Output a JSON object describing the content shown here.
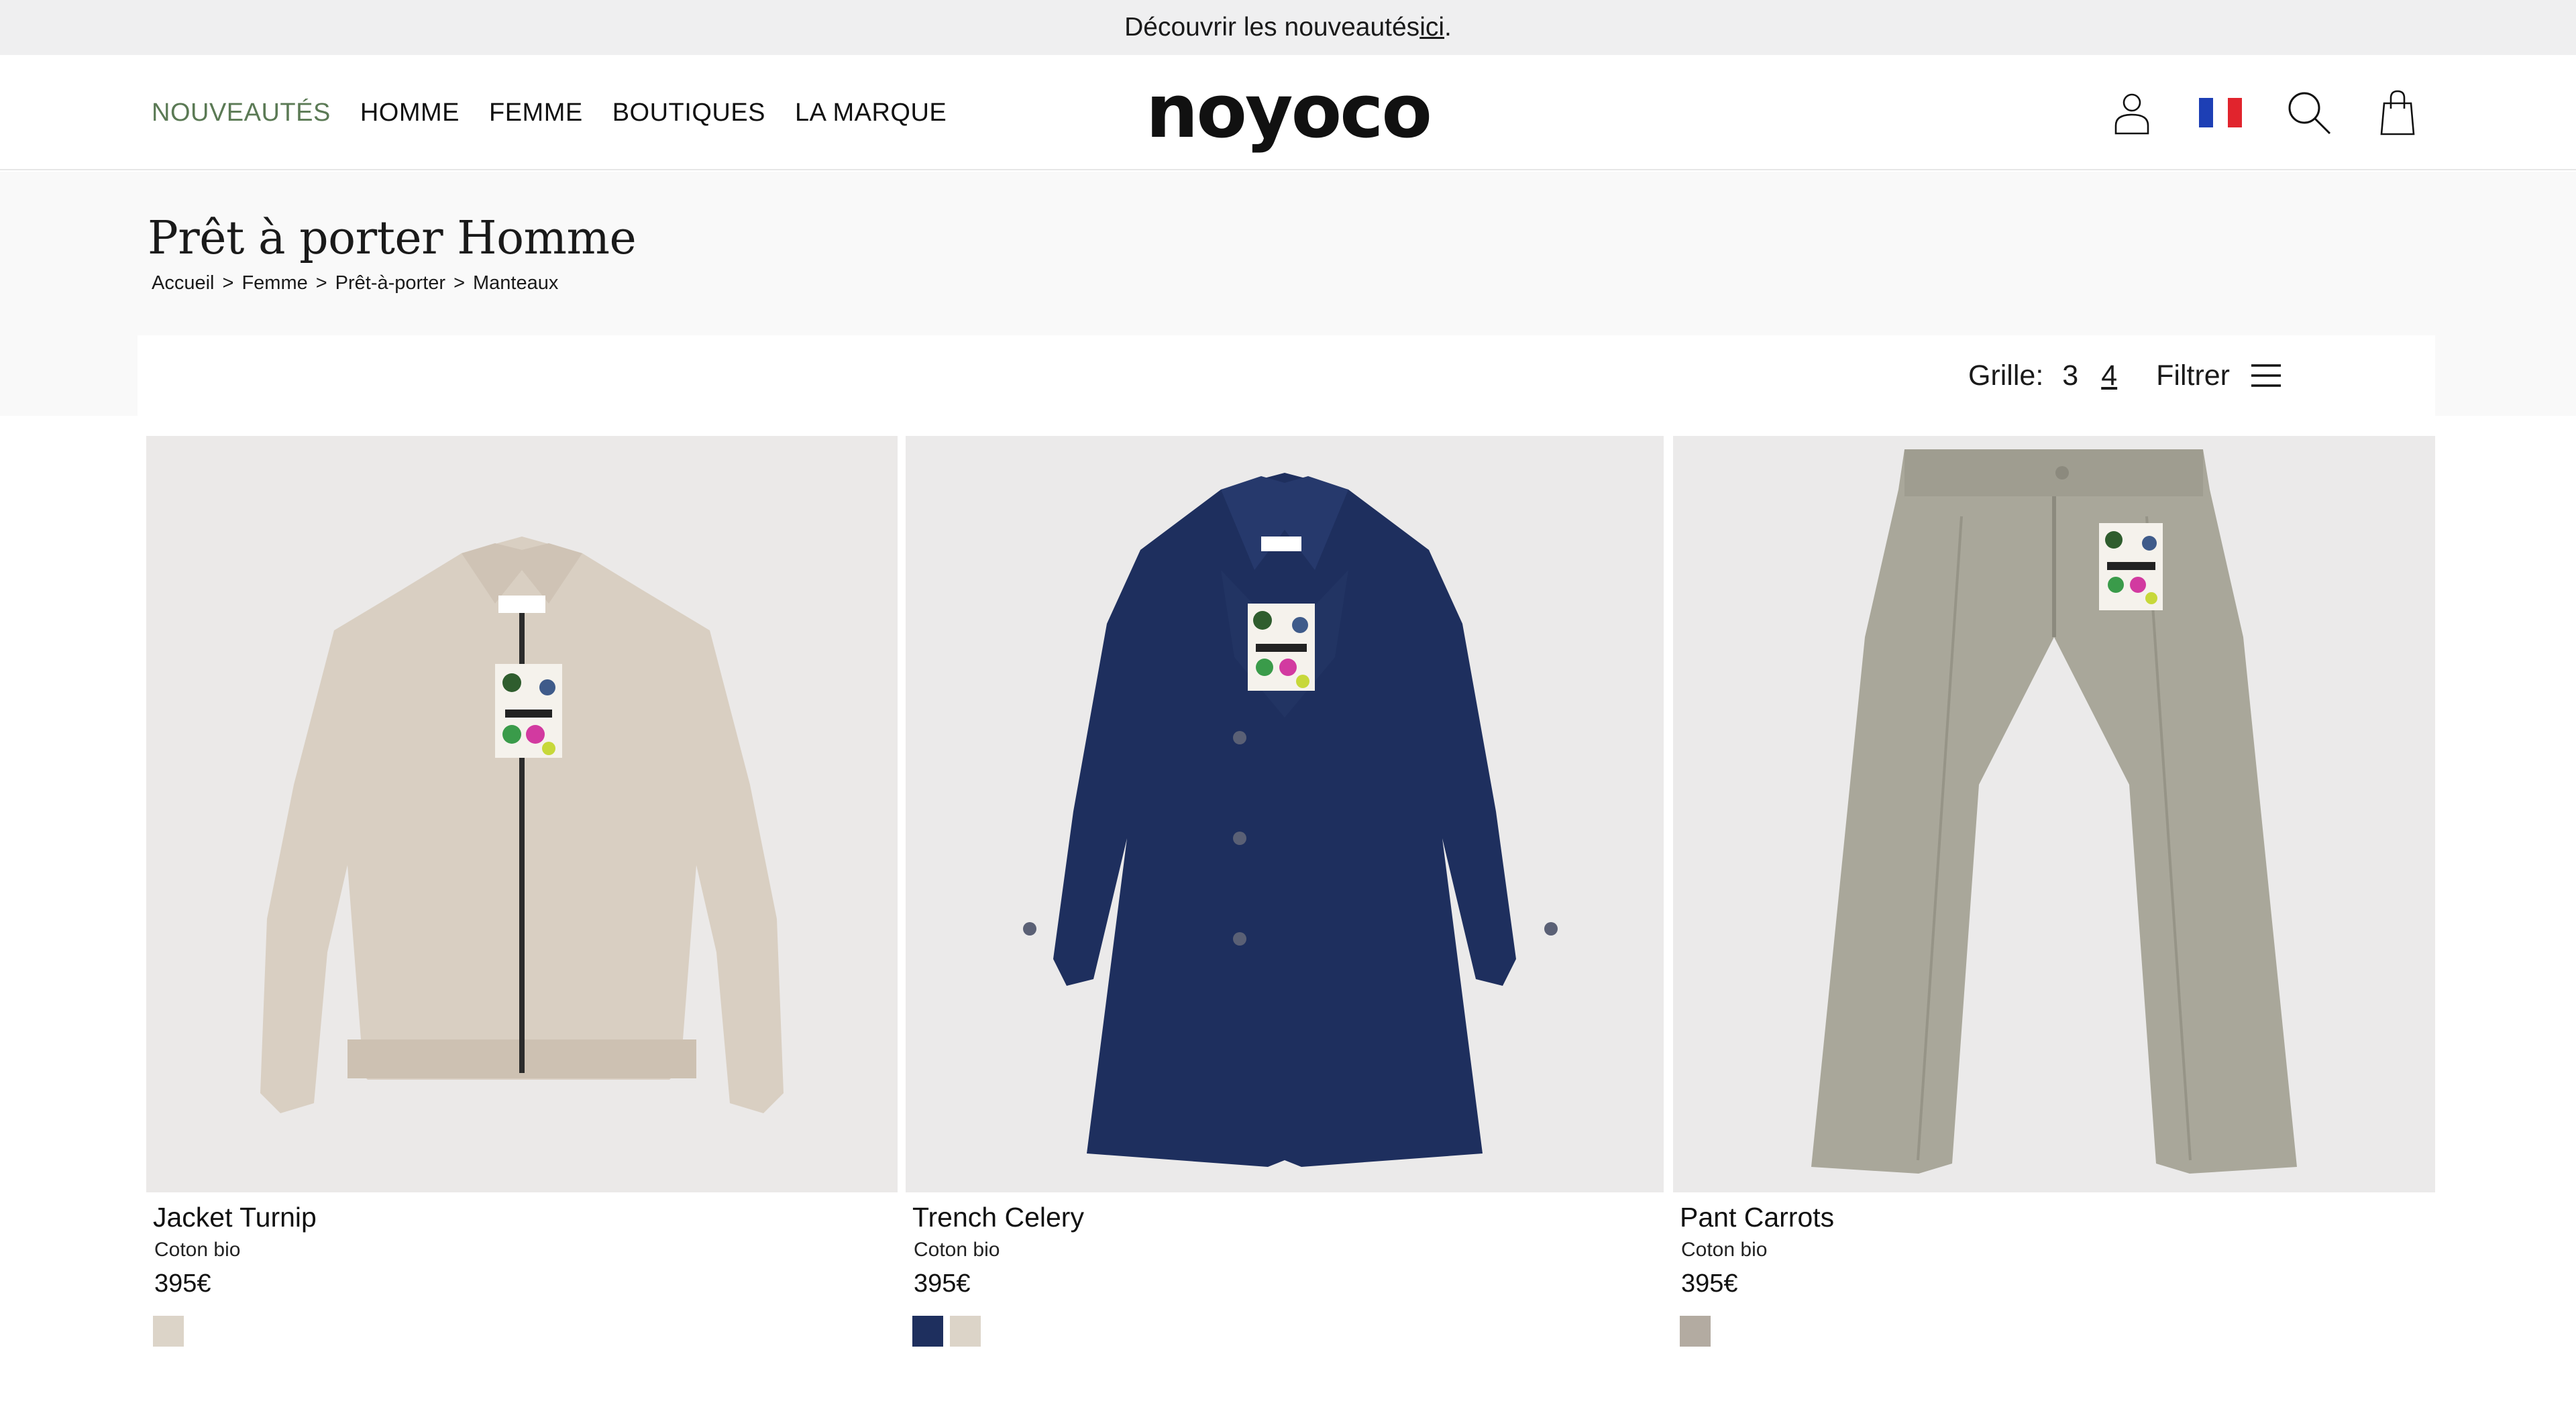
{
  "announcement": {
    "text": "Découvrir les nouveautés ",
    "link": "ici",
    "end": "."
  },
  "nav": {
    "items": [
      {
        "label": "NOUVEAUTÉS"
      },
      {
        "label": "HOMME"
      },
      {
        "label": "FEMME"
      },
      {
        "label": "BOUTIQUES"
      },
      {
        "label": "LA MARQUE"
      }
    ]
  },
  "brand": {
    "logo": "noyoco"
  },
  "header_icons": [
    "account-icon",
    "france-flag-icon",
    "search-icon",
    "shopping-bag-icon"
  ],
  "page": {
    "title": "Prêt à porter Homme",
    "breadcrumb": [
      "Accueil",
      "Femme",
      "Prêt-à-porter",
      "Manteaux"
    ],
    "breadcrumb_sep": ">"
  },
  "toolbar": {
    "grid_label": "Grille:",
    "grid_options": [
      "3",
      "4"
    ],
    "grid_selected": "4",
    "filter_label": "Filtrer"
  },
  "products": [
    {
      "name": "Jacket Turnip",
      "material": "Coton bio",
      "price": "395€",
      "swatches": [
        "#dcd4c8"
      ]
    },
    {
      "name": "Trench Celery",
      "material": "Coton bio",
      "price": "395€",
      "swatches": [
        "#1e2f5e",
        "#dcd4c8"
      ]
    },
    {
      "name": "Pant Carrots",
      "material": "Coton bio",
      "price": "395€",
      "swatches": [
        "#b3aba1"
      ]
    }
  ],
  "colors": {
    "accent_green": "#5b7a55",
    "navy": "#1e2f5e",
    "beige": "#d9cfc2",
    "olive_grey": "#a9a79a"
  }
}
